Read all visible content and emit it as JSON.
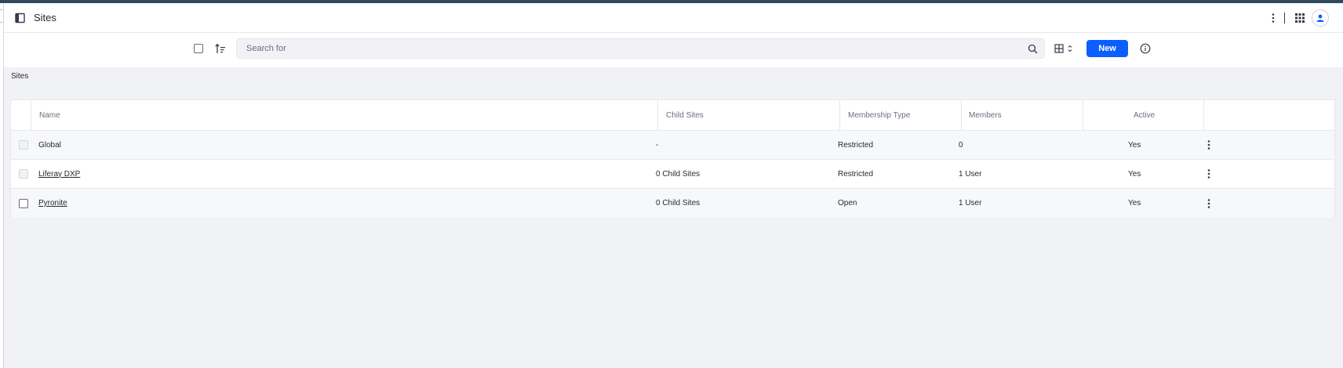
{
  "header": {
    "title": "Sites",
    "icons": {
      "panel": "sidebar-panel-icon",
      "more": "vertical-ellipsis-icon",
      "apps": "grid-apps-icon",
      "user": "user-avatar-icon"
    }
  },
  "toolbar": {
    "search_placeholder": "Search for",
    "new_label": "New"
  },
  "breadcrumb": "Sites",
  "table": {
    "columns": [
      "Name",
      "Child Sites",
      "Membership Type",
      "Members",
      "Active"
    ],
    "rows": [
      {
        "name": "Global",
        "name_is_link": false,
        "child_sites": "-",
        "membership_type": "Restricted",
        "members": "0",
        "active": "Yes",
        "selectable": false
      },
      {
        "name": "Liferay DXP",
        "name_is_link": true,
        "child_sites": "0 Child Sites",
        "membership_type": "Restricted",
        "members": "1 User",
        "active": "Yes",
        "selectable": false
      },
      {
        "name": "Pyronite",
        "name_is_link": true,
        "child_sites": "0 Child Sites",
        "membership_type": "Open",
        "members": "1 User",
        "active": "Yes",
        "selectable": true
      }
    ]
  },
  "colors": {
    "primary": "#0b5fff",
    "background": "#f1f2f5",
    "text": "#272833",
    "muted": "#6b6c7e"
  }
}
